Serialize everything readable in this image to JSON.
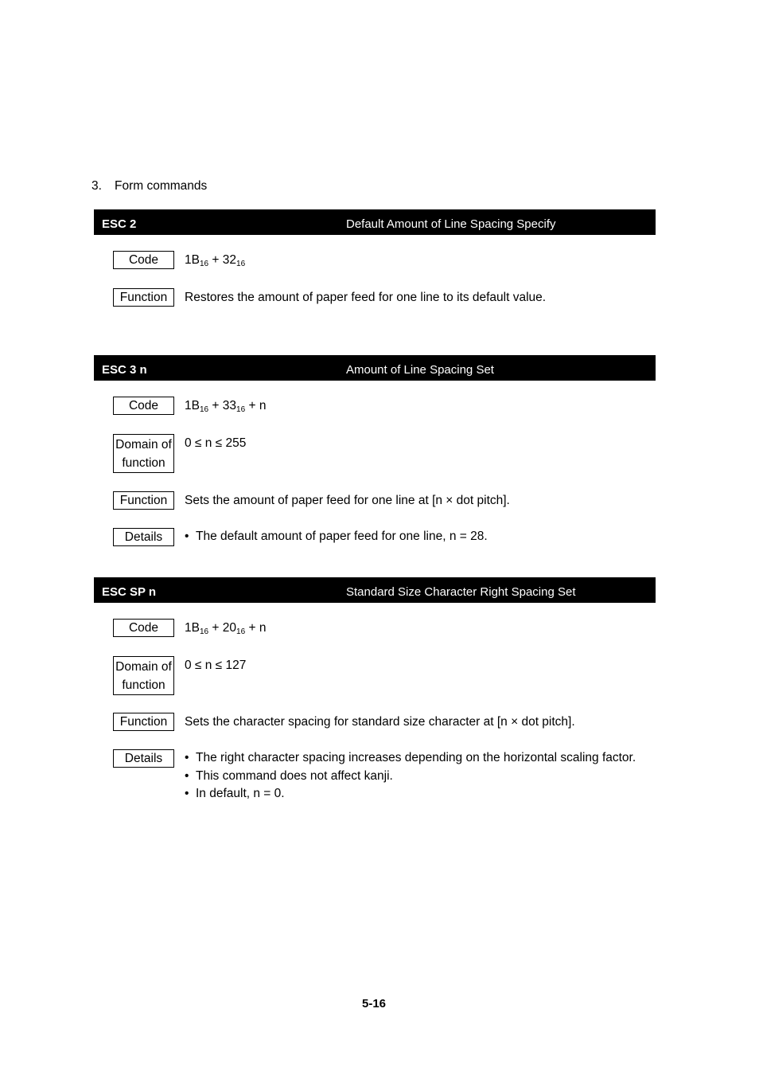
{
  "section": {
    "number": "3.",
    "title": "Form commands"
  },
  "commands": [
    {
      "command": "ESC 2",
      "title": "Default Amount of Line Spacing Specify",
      "code": [
        {
          "base": "1B",
          "sub": "16"
        },
        {
          "base": "32",
          "sub": "16"
        }
      ],
      "code_text": "1B16 + 3216",
      "function": "Restores the amount of paper feed for one line to its default value."
    },
    {
      "command": "ESC 3 n",
      "title": "Amount of Line Spacing Set",
      "code_text": "1B16 + 3316 + n",
      "domain": "0 ≤ n ≤ 255",
      "function": "Sets the amount of paper feed for one line at [n × dot pitch].",
      "details": [
        "The default amount of paper feed for one line, n = 28."
      ]
    },
    {
      "command": "ESC SP n",
      "title": "Standard Size Character Right Spacing Set",
      "code_text": "1B16 + 2016 + n",
      "domain": "0 ≤ n ≤ 127",
      "function": "Sets the character spacing for standard size character at [n × dot pitch].",
      "details": [
        "The right character spacing increases depending on the horizontal scaling factor.",
        "This command does not affect kanji.",
        "In default, n = 0."
      ]
    }
  ],
  "labels": {
    "code": "Code",
    "domain_line1": "Domain of",
    "domain_line2": "function",
    "function": "Function",
    "details": "Details"
  },
  "code_parts": {
    "b1": "1B",
    "s16": "16",
    "plus": " + ",
    "n": "n",
    "c0": "32",
    "c1": "33",
    "c2": "20"
  },
  "bullet": "•",
  "page_number": "5-16"
}
